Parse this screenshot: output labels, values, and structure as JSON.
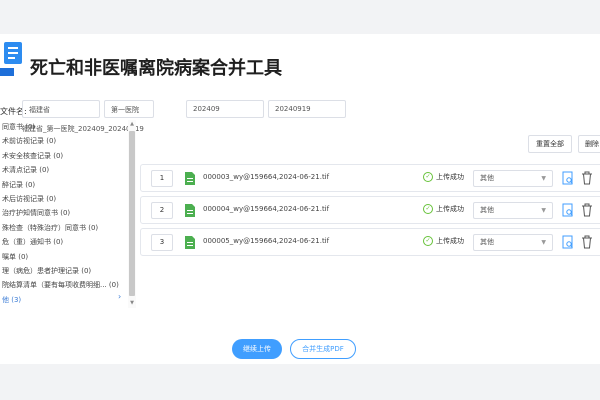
{
  "app": {
    "title": "死亡和非医嘱离院病案合并工具"
  },
  "form": {
    "file_label": "文件名:",
    "province": "福建省",
    "hospital": "第一医院",
    "start_date": "202409",
    "end_date": "20240919",
    "file_name": "福建省_第一医院_202409_20240919"
  },
  "toolbar": {
    "reset_label": "重置全部",
    "delete_label": "删除"
  },
  "categories": [
    "同意书 (0)",
    "术前访视记录 (0)",
    "术安全核查记录 (0)",
    "术清点记录 (0)",
    "醉记录 (0)",
    "术后访视记录 (0)",
    "治疗护知情同意书 (0)",
    "殊检查（特殊治疗）同意书 (0)",
    "危（重）通知书 (0)",
    "嘱单 (0)",
    "理（病危）患者护理记录 (0)",
    "院结算清单（要有每项收费明细... (0)",
    "他 (3)"
  ],
  "files": [
    {
      "index": "1",
      "name": "000003_wy@159664,2024-06-21.tif",
      "status": "上传成功",
      "type": "其他"
    },
    {
      "index": "2",
      "name": "000004_wy@159664,2024-06-21.tif",
      "status": "上传成功",
      "type": "其他"
    },
    {
      "index": "3",
      "name": "000005_wy@159664,2024-06-21.tif",
      "status": "上传成功",
      "type": "其他"
    }
  ],
  "actions": {
    "continue_label": "继续上传",
    "merge_label": "合并生成PDF"
  },
  "colors": {
    "primary": "#409eff",
    "success": "#67c23a",
    "doc_green": "#4caf50"
  }
}
